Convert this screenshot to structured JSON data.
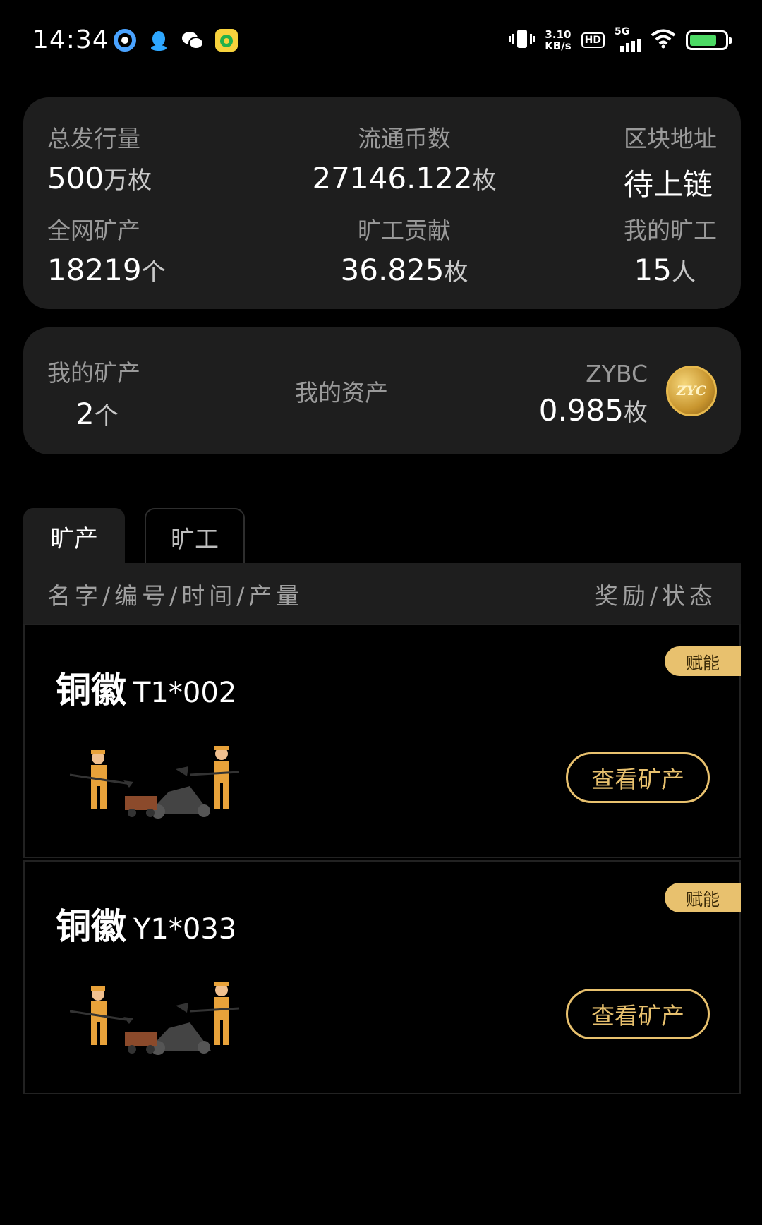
{
  "status_bar": {
    "time": "14:34",
    "speed_value": "3.10",
    "speed_unit": "KB/s",
    "hd": "HD",
    "network": "5G",
    "icons": [
      "browser-icon",
      "qq-icon",
      "wechat-icon",
      "qq-music-icon",
      "vibrate-icon",
      "wifi-icon",
      "battery-icon"
    ]
  },
  "stats": {
    "total_supply": {
      "label": "总发行量",
      "value": "500",
      "unit": "万枚"
    },
    "circulating": {
      "label": "流通币数",
      "value": "27146.122",
      "unit": "枚"
    },
    "block_address": {
      "label": "区块地址",
      "value": "待上链"
    },
    "network_mines": {
      "label": "全网矿产",
      "value": "18219",
      "unit": "个"
    },
    "miner_contribution": {
      "label": "旷工贡献",
      "value": "36.825",
      "unit": "枚"
    },
    "my_miners": {
      "label": "我的旷工",
      "value": "15",
      "unit": "人"
    }
  },
  "assets": {
    "my_mines_label": "我的矿产",
    "my_mines_value": "2",
    "my_mines_unit": "个",
    "my_assets_label": "我的资产",
    "coin_symbol": "ZYBC",
    "coin_value": "0.985",
    "coin_unit": "枚",
    "coin_logo_text": "ZYC"
  },
  "tabs": [
    {
      "label": "旷产",
      "active": true
    },
    {
      "label": "旷工",
      "active": false
    }
  ],
  "list_header": {
    "left": "名字/编号/时间/产量",
    "right": "奖励/状态"
  },
  "items": [
    {
      "name": "铜徽",
      "code": "T1*002",
      "tag": "赋能",
      "button": "查看矿产"
    },
    {
      "name": "铜徽",
      "code": "Y1*033",
      "tag": "赋能",
      "button": "查看矿产"
    }
  ],
  "colors": {
    "background": "#000000",
    "card": "#1e1e1e",
    "accent_gold": "#e8c16e"
  }
}
